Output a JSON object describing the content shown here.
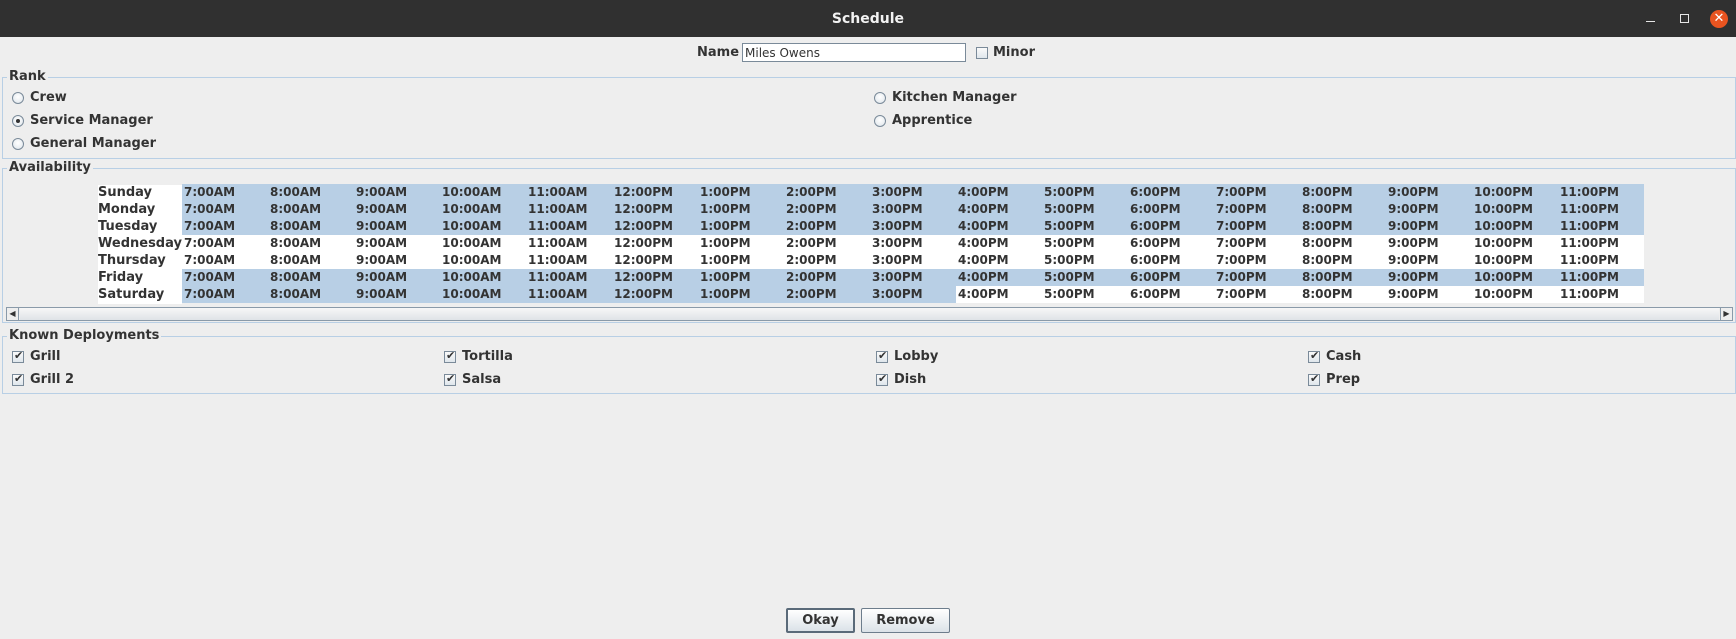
{
  "window": {
    "title": "Schedule"
  },
  "name_label": "Name",
  "name_value": "Miles Owens",
  "minor_label": "Minor",
  "rank": {
    "title": "Rank",
    "options": [
      {
        "label": "Crew",
        "selected": false
      },
      {
        "label": "Kitchen Manager",
        "selected": false
      },
      {
        "label": "Service Manager",
        "selected": true
      },
      {
        "label": "Apprentice",
        "selected": false
      },
      {
        "label": "General Manager",
        "selected": false
      }
    ]
  },
  "availability": {
    "title": "Availability",
    "times": [
      "7:00AM",
      "8:00AM",
      "9:00AM",
      "10:00AM",
      "11:00AM",
      "12:00PM",
      "1:00PM",
      "2:00PM",
      "3:00PM",
      "4:00PM",
      "5:00PM",
      "6:00PM",
      "7:00PM",
      "8:00PM",
      "9:00PM",
      "10:00PM",
      "11:00PM"
    ],
    "days": [
      {
        "name": "Sunday",
        "selected_slots": 17
      },
      {
        "name": "Monday",
        "selected_slots": 17
      },
      {
        "name": "Tuesday",
        "selected_slots": 17
      },
      {
        "name": "Wednesday",
        "selected_slots": 0
      },
      {
        "name": "Thursday",
        "selected_slots": 0
      },
      {
        "name": "Friday",
        "selected_slots": 17
      },
      {
        "name": "Saturday",
        "selected_slots": 9
      }
    ],
    "selection_color": "#b8cfe5"
  },
  "deployments": {
    "title": "Known Deployments",
    "items": [
      {
        "label": "Grill",
        "checked": true
      },
      {
        "label": "Tortilla",
        "checked": true
      },
      {
        "label": "Lobby",
        "checked": true
      },
      {
        "label": "Cash",
        "checked": true
      },
      {
        "label": "Grill 2",
        "checked": true
      },
      {
        "label": "Salsa",
        "checked": true
      },
      {
        "label": "Dish",
        "checked": true
      },
      {
        "label": "Prep",
        "checked": true
      }
    ]
  },
  "buttons": {
    "okay": "Okay",
    "remove": "Remove"
  }
}
